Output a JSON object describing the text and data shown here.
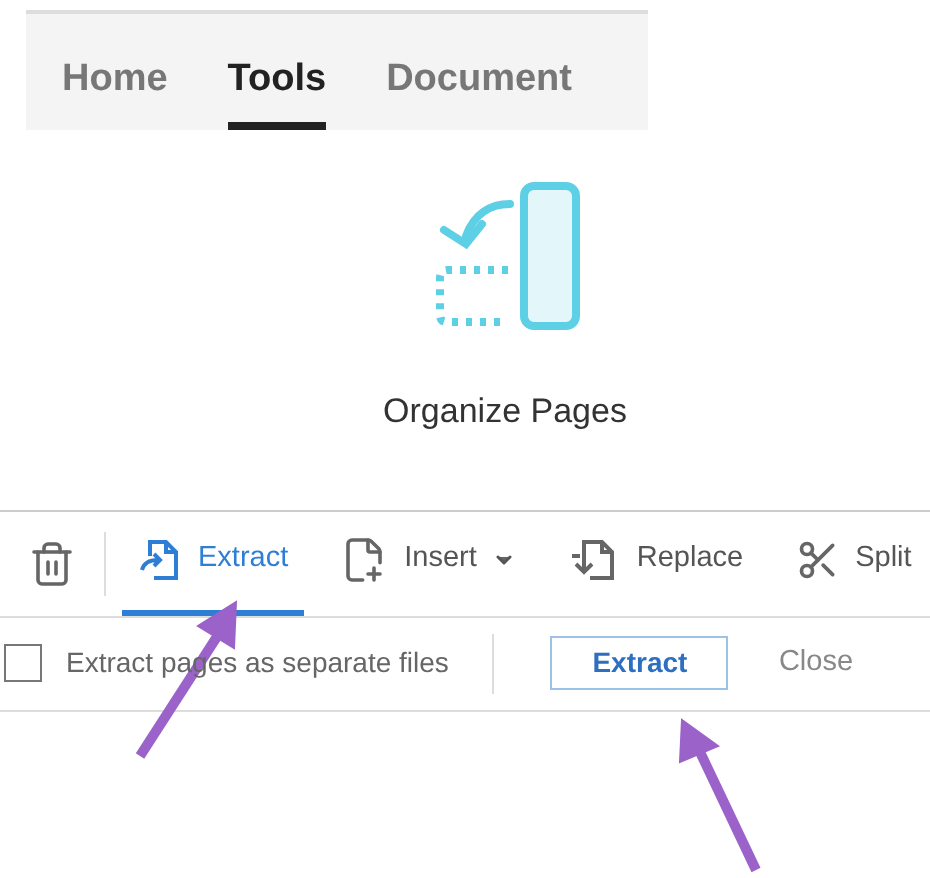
{
  "tabs": [
    {
      "label": "Home",
      "selected": false
    },
    {
      "label": "Tools",
      "selected": true
    },
    {
      "label": "Document",
      "selected": false
    }
  ],
  "tool": {
    "label": "Organize Pages"
  },
  "toolbar": [
    {
      "kind": "delete"
    },
    {
      "kind": "extract",
      "label": "Extract",
      "selected": true
    },
    {
      "kind": "insert",
      "label": "Insert",
      "selected": false
    },
    {
      "kind": "replace",
      "label": "Replace",
      "selected": false
    },
    {
      "kind": "split",
      "label": "Split",
      "selected": false
    }
  ],
  "options": {
    "checkbox_label": "Extract pages as separate files",
    "checked": false,
    "primary_button": "Extract",
    "close_button": "Close"
  }
}
